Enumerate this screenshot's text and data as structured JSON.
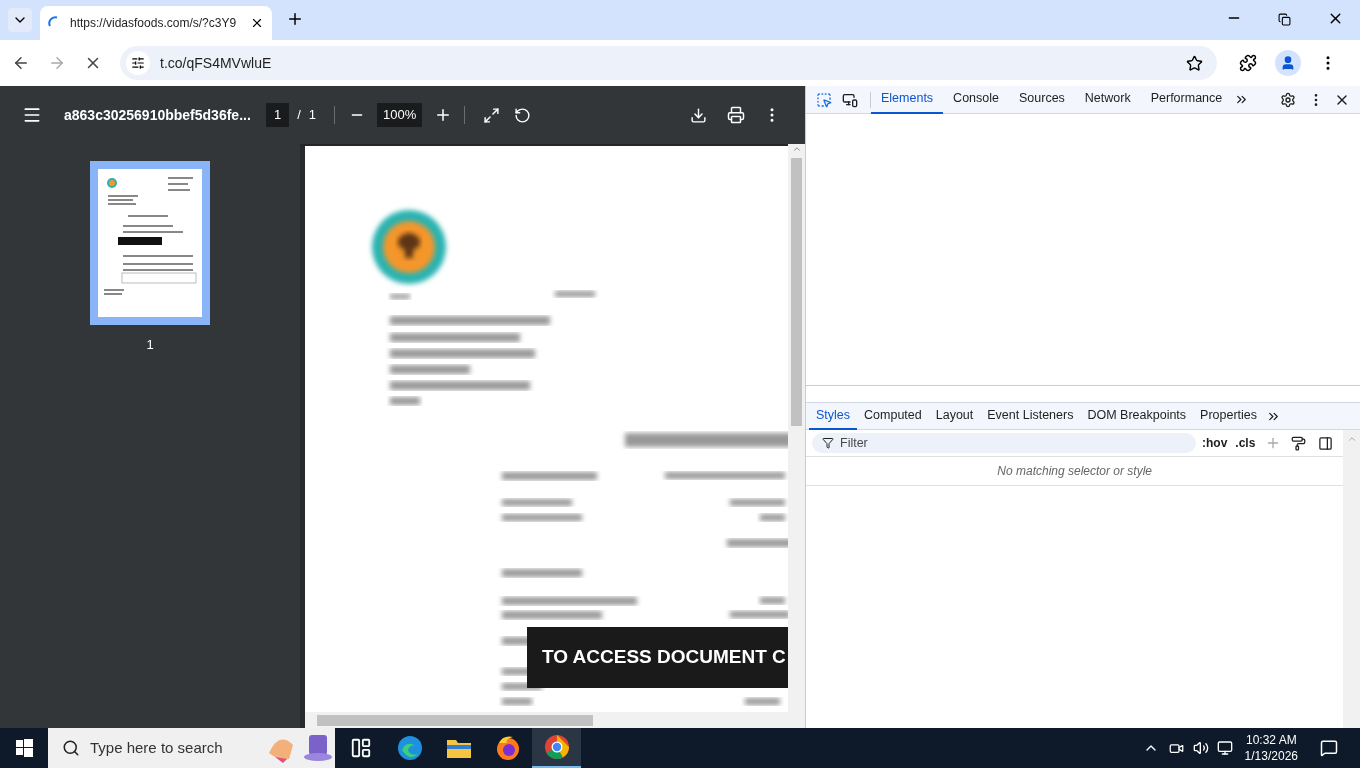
{
  "browser": {
    "tab": {
      "title": "https://vidasfoods.com/s/?c3Y9",
      "loading": true
    },
    "address": "t.co/qFS4MVwluE",
    "loading": true
  },
  "pdf_viewer": {
    "filename": "a863c30256910bbef5d36fe...",
    "page": "1",
    "separator": "/",
    "page_total": "1",
    "zoom": "100%",
    "thumbnails": [
      {
        "label": "1",
        "selected": true
      }
    ],
    "overlay_text": "TO ACCESS DOCUMENT C"
  },
  "devtools": {
    "tabs": [
      {
        "label": "Elements",
        "selected": true
      },
      {
        "label": "Console",
        "selected": false
      },
      {
        "label": "Sources",
        "selected": false
      },
      {
        "label": "Network",
        "selected": false
      },
      {
        "label": "Performance",
        "selected": false
      }
    ],
    "styles_tabs": [
      {
        "label": "Styles",
        "selected": true
      },
      {
        "label": "Computed",
        "selected": false
      },
      {
        "label": "Layout",
        "selected": false
      },
      {
        "label": "Event Listeners",
        "selected": false
      },
      {
        "label": "DOM Breakpoints",
        "selected": false
      },
      {
        "label": "Properties",
        "selected": false
      }
    ],
    "filter_placeholder": "Filter",
    "hov": ":hov",
    "cls": ".cls",
    "empty_message": "No matching selector or style"
  },
  "taskbar": {
    "search_placeholder": "Type here to search",
    "apps": [
      {
        "kind": "task-view",
        "selected": false
      },
      {
        "kind": "edge",
        "selected": false
      },
      {
        "kind": "explorer",
        "selected": false
      },
      {
        "kind": "firefox",
        "selected": false
      },
      {
        "kind": "chrome",
        "selected": true
      }
    ],
    "time": "10:32 AM",
    "date": "1/13/2026"
  }
}
